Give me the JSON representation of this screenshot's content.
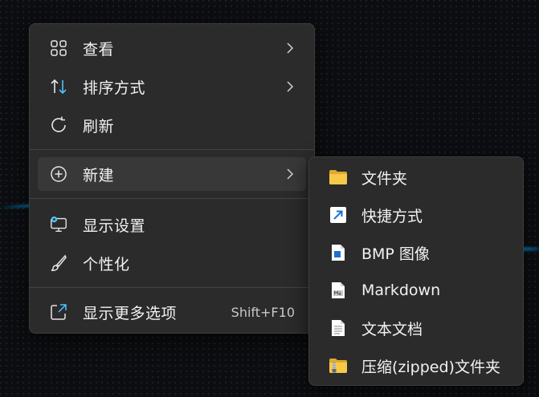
{
  "context_menu": {
    "items": [
      {
        "label": "查看",
        "icon": "grid-view-icon",
        "has_submenu": true
      },
      {
        "label": "排序方式",
        "icon": "sort-arrows-icon",
        "has_submenu": true
      },
      {
        "label": "刷新",
        "icon": "refresh-icon",
        "has_submenu": false
      },
      {
        "label": "新建",
        "icon": "add-circle-icon",
        "has_submenu": true,
        "active": true
      },
      {
        "label": "显示设置",
        "icon": "display-settings-icon",
        "has_submenu": false
      },
      {
        "label": "个性化",
        "icon": "brush-icon",
        "has_submenu": false
      },
      {
        "label": "显示更多选项",
        "icon": "open-external-icon",
        "shortcut": "Shift+F10"
      }
    ]
  },
  "new_submenu": {
    "items": [
      {
        "label": "文件夹",
        "icon": "folder-icon"
      },
      {
        "label": "快捷方式",
        "icon": "shortcut-icon"
      },
      {
        "label": "BMP 图像",
        "icon": "bmp-file-icon"
      },
      {
        "label": "Markdown",
        "icon": "markdown-file-icon"
      },
      {
        "label": "文本文档",
        "icon": "text-document-icon"
      },
      {
        "label": "压缩(zipped)文件夹",
        "icon": "zipped-folder-icon"
      }
    ]
  },
  "colors": {
    "menu_bg": "#2b2b2b",
    "hover_bg": "#383838",
    "accent": "#4cc2ff",
    "folder": "#f5c54a"
  }
}
